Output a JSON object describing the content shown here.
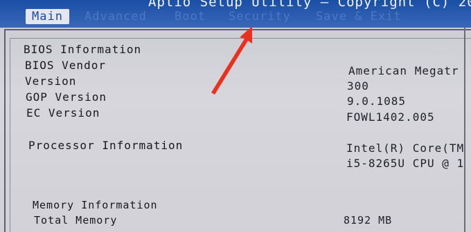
{
  "header": {
    "title": "Aptio Setup Utility – Copyright (C) 20"
  },
  "tabs": [
    {
      "label": "Main",
      "active": true
    },
    {
      "label": "Advanced",
      "active": false
    },
    {
      "label": "Boot",
      "active": false
    },
    {
      "label": "Security",
      "active": false
    },
    {
      "label": "Save & Exit",
      "active": false
    }
  ],
  "info": {
    "bios_information": "BIOS Information",
    "bios_vendor_label": "BIOS Vendor",
    "bios_vendor_value": "American Megatr",
    "version_label": "Version",
    "version_value": "300",
    "gop_version_label": "GOP Version",
    "gop_version_value": "9.0.1085",
    "ec_version_label": "EC Version",
    "ec_version_value": "FOWL1402.005",
    "processor_information_label": "Processor Information",
    "processor_value_line1": "Intel(R) Core(TM",
    "processor_value_line2": "i5-8265U CPU @ 1",
    "memory_information_label": "Memory Information",
    "total_memory_label": "Total Memory",
    "total_memory_value": "8192 MB"
  },
  "annotation": {
    "arrow_color": "#e8321f",
    "icon": "red-arrow-pointer-icon"
  },
  "colors": {
    "title_band": "#2b5cb0",
    "active_tab_bg": "#e3e6ee",
    "panel_bg": "#d2d2d8"
  }
}
